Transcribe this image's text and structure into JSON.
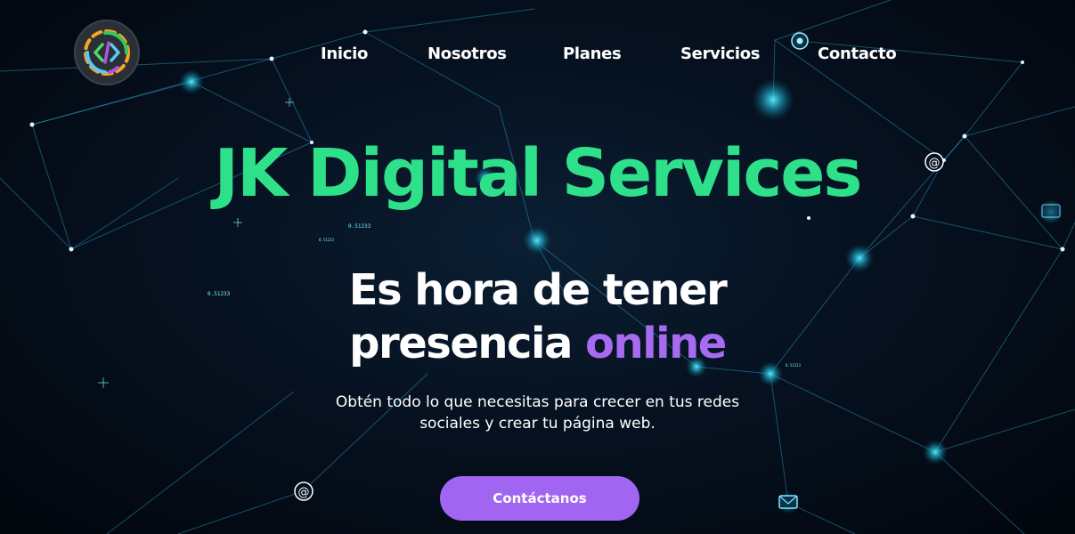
{
  "nav": {
    "items": [
      "Inicio",
      "Nosotros",
      "Planes",
      "Servicios",
      "Contacto"
    ]
  },
  "hero": {
    "brand": "JK Digital Services",
    "headline_line1": "Es hora de tener",
    "headline_line2_prefix": "presencia ",
    "headline_line2_accent": "online",
    "subtitle": "Obtén todo lo que necesitas para crecer en tus redes sociales y crear tu página web.",
    "cta_label": "Contáctanos"
  },
  "background_numbers": [
    "0.51233",
    "0.51233",
    "0.51233",
    "0.51233"
  ],
  "colors": {
    "brand_green": "#2fe08a",
    "accent_purple": "#a66bf0",
    "button_purple": "#a066f2",
    "network_cyan": "#3fd8ff"
  },
  "icons": [
    "code-logo-icon",
    "at-sign-icon",
    "envelope-icon",
    "network-node-icon"
  ]
}
